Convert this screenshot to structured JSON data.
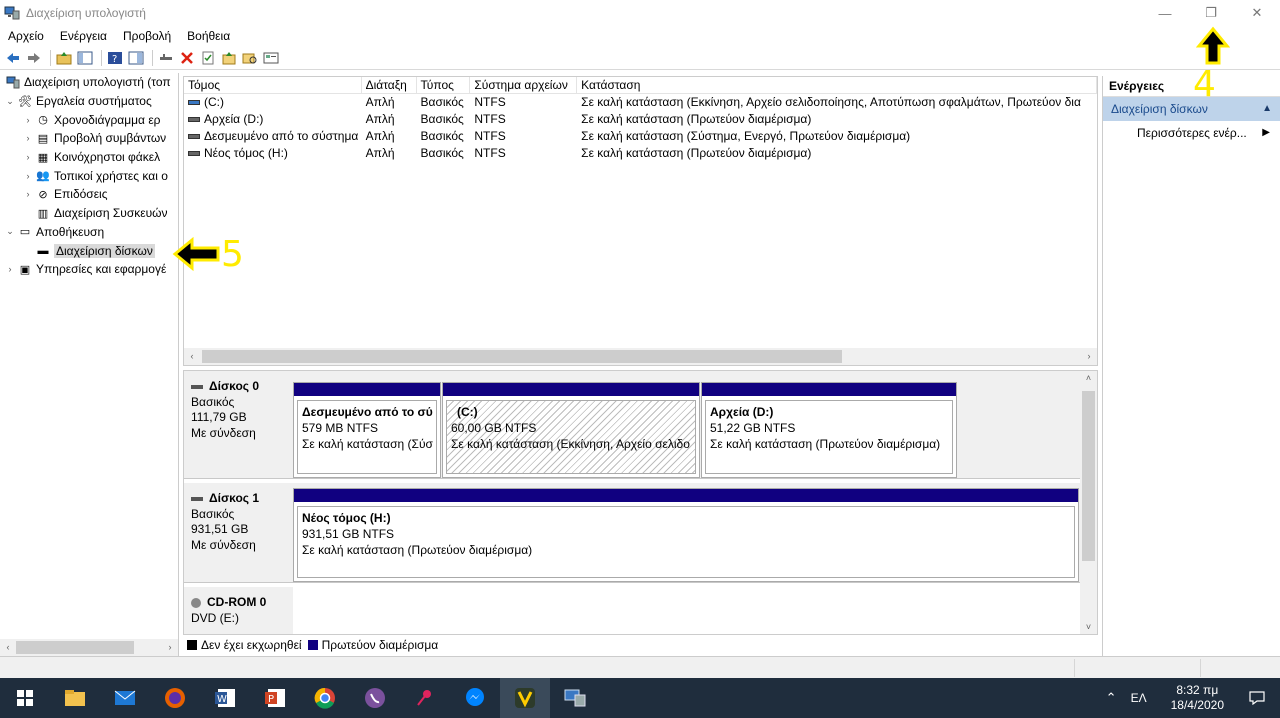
{
  "window": {
    "title": "Διαχείριση υπολογιστή",
    "minimize": "—",
    "restore": "❐",
    "close": "✕"
  },
  "menu": [
    "Αρχείο",
    "Ενέργεια",
    "Προβολή",
    "Βοήθεια"
  ],
  "tree": {
    "root": "Διαχείριση υπολογιστή (τοπ",
    "items": [
      {
        "label": "Εργαλεία συστήματος",
        "level": 1,
        "expander": "⌄",
        "icon": "tools-icon"
      },
      {
        "label": "Χρονοδιάγραμμα ερ",
        "level": 2,
        "expander": "›",
        "icon": "clock-icon"
      },
      {
        "label": "Προβολή συμβάντων",
        "level": 2,
        "expander": "›",
        "icon": "event-viewer-icon"
      },
      {
        "label": "Κοινόχρηστοι φάκελ",
        "level": 2,
        "expander": "›",
        "icon": "shared-folder-icon"
      },
      {
        "label": "Τοπικοί χρήστες και ο",
        "level": 2,
        "expander": "›",
        "icon": "users-icon"
      },
      {
        "label": "Επιδόσεις",
        "level": 2,
        "expander": "›",
        "icon": "performance-icon"
      },
      {
        "label": "Διαχείριση Συσκευών",
        "level": 2,
        "expander": "",
        "icon": "device-manager-icon"
      },
      {
        "label": "Αποθήκευση",
        "level": 1,
        "expander": "⌄",
        "icon": "storage-icon"
      },
      {
        "label": "Διαχείριση δίσκων",
        "level": 2,
        "expander": "",
        "icon": "disk-icon",
        "selected": true
      },
      {
        "label": "Υπηρεσίες και εφαρμογέ",
        "level": 1,
        "expander": "›",
        "icon": "services-icon"
      }
    ]
  },
  "volumes": {
    "columns": [
      "Τόμος",
      "Διάταξη",
      "Τύπος",
      "Σύστημα αρχείων",
      "Κατάσταση"
    ],
    "rows": [
      [
        "(C:)",
        "Απλή",
        "Βασικός",
        "NTFS",
        "Σε καλή κατάσταση (Εκκίνηση, Αρχείο σελιδοποίησης, Αποτύπωση σφαλμάτων, Πρωτεύον δια"
      ],
      [
        "Αρχεία (D:)",
        "Απλή",
        "Βασικός",
        "NTFS",
        "Σε καλή κατάσταση (Πρωτεύον διαμέρισμα)"
      ],
      [
        "Δεσμευμένο από το σύστημα",
        "Απλή",
        "Βασικός",
        "NTFS",
        "Σε καλή κατάσταση (Σύστημα, Ενεργό, Πρωτεύον διαμέρισμα)"
      ],
      [
        "Νέος τόμος (H:)",
        "Απλή",
        "Βασικός",
        "NTFS",
        "Σε καλή κατάσταση (Πρωτεύον διαμέρισμα)"
      ]
    ]
  },
  "disks": [
    {
      "name": "Δίσκος 0",
      "type": "Βασικός",
      "size": "111,79 GB",
      "state": "Με σύνδεση",
      "partitions": [
        {
          "name": "Δεσμευμένο από το σύ",
          "size": "579 MB NTFS",
          "status": "Σε καλή κατάσταση (Σύσ"
        },
        {
          "name": "(C:)",
          "size": "60,00 GB NTFS",
          "status": "Σε καλή κατάσταση (Εκκίνηση, Αρχείο σελιδο"
        },
        {
          "name": "Αρχεία  (D:)",
          "size": "51,22 GB NTFS",
          "status": "Σε καλή κατάσταση (Πρωτεύον διαμέρισμα)"
        }
      ]
    },
    {
      "name": "Δίσκος 1",
      "type": "Βασικός",
      "size": "931,51 GB",
      "state": "Με σύνδεση",
      "partitions": [
        {
          "name": "Νέος τόμος  (H:)",
          "size": "931,51 GB NTFS",
          "status": "Σε καλή κατάσταση (Πρωτεύον διαμέρισμα)"
        }
      ]
    },
    {
      "name": "CD-ROM 0",
      "type": "DVD (E:)"
    }
  ],
  "legend": {
    "unallocated": "Δεν έχει εκχωρηθεί",
    "primary": "Πρωτεύον διαμέρισμα",
    "unallocated_color": "#000000",
    "primary_color": "#100080"
  },
  "actions": {
    "title": "Ενέργειες",
    "section": "Διαχείριση δίσκων",
    "more": "Περισσότερες ενέρ..."
  },
  "annotations": {
    "step4": "4",
    "step5": "5",
    "color": "#ffeb00"
  },
  "taskbar": {
    "apps": [
      "start-icon",
      "file-explorer-icon",
      "mail-icon",
      "firefox-icon",
      "word-icon",
      "powerpoint-icon",
      "chrome-icon",
      "viber-icon",
      "pin-icon",
      "messenger-icon",
      "vivaldi-icon",
      "computer-management-icon"
    ],
    "language": "ΕΛ",
    "time": "8:32 πμ",
    "date": "18/4/2020"
  }
}
